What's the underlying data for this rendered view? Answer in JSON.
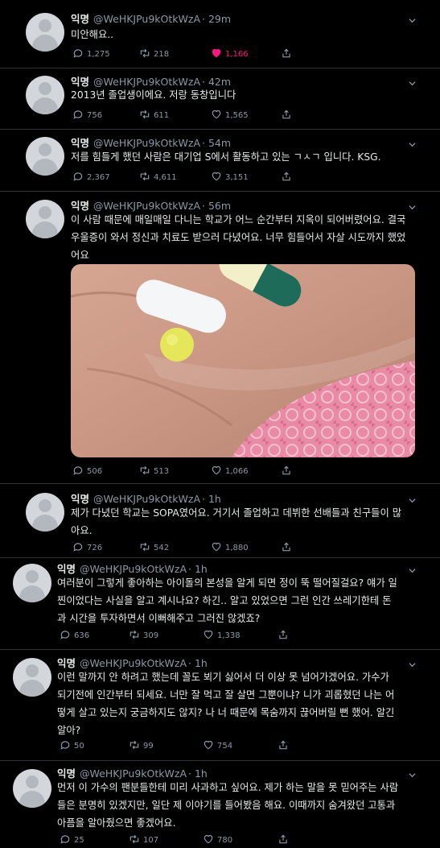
{
  "tweets": [
    {
      "name": "익명",
      "handle": "@WeHKJPu9kOtkWzA",
      "time": "· 29m",
      "text": "미안해요..",
      "replies": "1,275",
      "retweets": "218",
      "likes": "1,166",
      "liked": true
    },
    {
      "name": "익명",
      "handle": "@WeHKJPu9kOtkWzA",
      "time": "· 42m",
      "text": "2013년 졸업생이에요. 저랑 동창입니다",
      "replies": "756",
      "retweets": "611",
      "likes": "1,565"
    },
    {
      "name": "익명",
      "handle": "@WeHKJPu9kOtkWzA",
      "time": "· 54m",
      "text": "저를 힘들게 했던 사람은 대기업 S에서 활동하고 있는 ㄱㅅㄱ 입니다. KSG.",
      "replies": "2,367",
      "retweets": "4,611",
      "likes": "3,151"
    },
    {
      "name": "익명",
      "handle": "@WeHKJPu9kOtkWzA",
      "time": "· 56m",
      "text": "이 사람 때문에 매일매일 다니는 학교가 어느 순간부터 지옥이 되어버렸어요. 결국\n우울증이 와서 정신과 치료도 받으러 다녔어요. 너무 힘들어서 자살 시도까지 했었\n어요",
      "replies": "506",
      "retweets": "513",
      "likes": "1,066"
    },
    {
      "name": "익명",
      "handle": "@WeHKJPu9kOtkWzA",
      "time": "· 1h",
      "text": "제가 다녔던 학교는 SOPA였어요. 거기서 졸업하고 데뷔한 선배들과 친구들이 많\n아요.",
      "replies": "726",
      "retweets": "542",
      "likes": "1,880"
    },
    {
      "name": "익명",
      "handle": "@WeHKJPu9kOtkWzA",
      "time": "· 1h",
      "text": "여러분이 그렇게 좋아하는 아이돌의 본성을 알게 되면 정이 뚝 떨어질걸요? 얘가 일\n찐이었다는 사실을 알고 계시나요? 하긴.. 알고 있었으면 그런 인간 쓰레기한테 돈\n과 시간을 투자하면서 이뻐해주고 그러진 않겠죠?",
      "replies": "636",
      "retweets": "309",
      "likes": "1,338"
    },
    {
      "name": "익명",
      "handle": "@WeHKJPu9kOtkWzA",
      "time": "· 1h",
      "text": "이런 말까지 안 하려고 했는데 꼴도 뵈기 싫어서 더 이상 못 넘어가겠어요. 가수가\n되기전에 인간부터 되세요. 너만 잘 먹고 잘 살면 그뿐이냐? 니가 괴롭혔던 나는 어\n떻게 살고 있는지 궁금하지도 않지? 나 너 때문에 목숨까지 끊어버릴 뻔 했어. 알긴\n알아?",
      "replies": "50",
      "retweets": "99",
      "likes": "754"
    },
    {
      "name": "익명",
      "handle": "@WeHKJPu9kOtkWzA",
      "time": "· 1h",
      "text": "먼저 이 가수의 팬분들한테 미리 사과하고 싶어요. 제가 하는 말을 못 믿어주는 사람\n들은 분명히 있겠지만, 일단 제 이야기를 들어봤음 해요. 이때까지 숨겨왔던 고통과\n아픔을 알아줬으면 좋겠어요.",
      "replies": "25",
      "retweets": "107",
      "likes": "780"
    }
  ],
  "colors": {
    "background": "#000000",
    "text": "#e7e9ea",
    "muted": "#8b98a5",
    "like": "#f91880"
  }
}
